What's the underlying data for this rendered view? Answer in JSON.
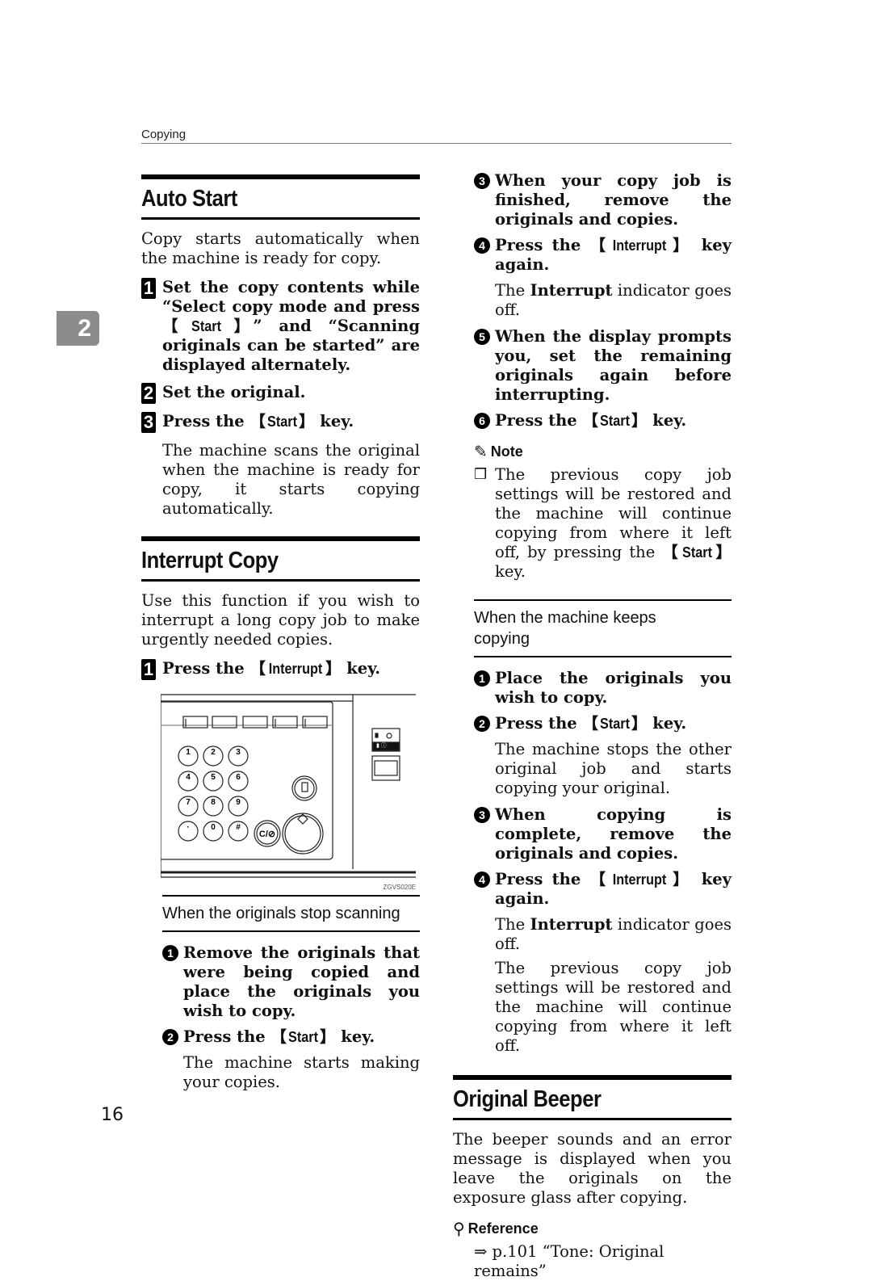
{
  "header": {
    "running_title": "Copying"
  },
  "chapter_tab": "2",
  "page_number": "16",
  "auto_start": {
    "title": "Auto Start",
    "intro": "Copy starts automatically when the machine is ready for copy.",
    "steps": [
      {
        "badge": "1",
        "text_before": "Set the copy contents while “Select copy mode and press ",
        "key": "Start",
        "text_after": "” and “Scanning originals can be started” are displayed alternately."
      },
      {
        "badge": "2",
        "text": "Set the original."
      },
      {
        "badge": "3",
        "text_before": "Press the ",
        "key": "Start",
        "text_after": " key.",
        "body": "The machine scans the original when the machine is ready for copy, it starts copying automatically."
      }
    ]
  },
  "interrupt_copy": {
    "title": "Interrupt Copy",
    "intro": "Use this function if you wish to interrupt a long copy job to make urgently needed copies.",
    "step1": {
      "badge": "1",
      "text_before": "Press the ",
      "key": "Interrupt",
      "text_after": " key."
    },
    "figure": {
      "id": "ZGVS020E",
      "keypad": [
        "1",
        "2",
        "3",
        "4",
        "5",
        "6",
        "7",
        "8",
        "9",
        "·",
        "0",
        "#"
      ],
      "clear_stop_label": "C/⊘"
    },
    "originals_stop": {
      "heading": "When the originals stop scanning",
      "steps": [
        {
          "num": "1",
          "text": "Remove the originals that were being copied and place the originals you wish to copy."
        },
        {
          "num": "2",
          "text_before": "Press the ",
          "key": "Start",
          "text_after": " key.",
          "body": "The machine starts making your copies."
        },
        {
          "num": "3",
          "text": "When your copy job is finished, remove the originals and copies."
        },
        {
          "num": "4",
          "text_before": "Press the ",
          "key": "Interrupt",
          "text_after": " key again.",
          "body_before": "The ",
          "body_bold": "Interrupt",
          "body_after": " indicator goes off."
        },
        {
          "num": "5",
          "text": "When the display prompts you, set the remaining originals again before interrupting."
        },
        {
          "num": "6",
          "text_before": "Press the ",
          "key": "Start",
          "text_after": " key."
        }
      ],
      "note": {
        "label": "Note",
        "item_before": "The previous copy job settings will be restored and the machine will continue copying from where it left off, by pressing the ",
        "key": "Start",
        "item_after": " key."
      }
    },
    "keeps_copying": {
      "heading": "When the machine keeps copying",
      "steps": [
        {
          "num": "1",
          "text": "Place the originals you wish to copy."
        },
        {
          "num": "2",
          "text_before": "Press the ",
          "key": "Start",
          "text_after": " key.",
          "body": "The machine stops the other original job and starts copying your original."
        },
        {
          "num": "3",
          "text": "When copying is complete, remove the originals and copies."
        },
        {
          "num": "4",
          "text_before": "Press the ",
          "key": "Interrupt",
          "text_after": " key again.",
          "body_before": "The ",
          "body_bold": "Interrupt",
          "body_after": " indicator goes off.",
          "body2": "The previous copy job settings will be restored and the machine will continue copying from where it left off."
        }
      ]
    }
  },
  "original_beeper": {
    "title": "Original Beeper",
    "body": "The beeper sounds and an error message is displayed when you leave the originals on the exposure glass after copying.",
    "reference": {
      "label": "Reference",
      "arrow": "⇒",
      "text": "p.101 “Tone: Original remains”"
    }
  }
}
